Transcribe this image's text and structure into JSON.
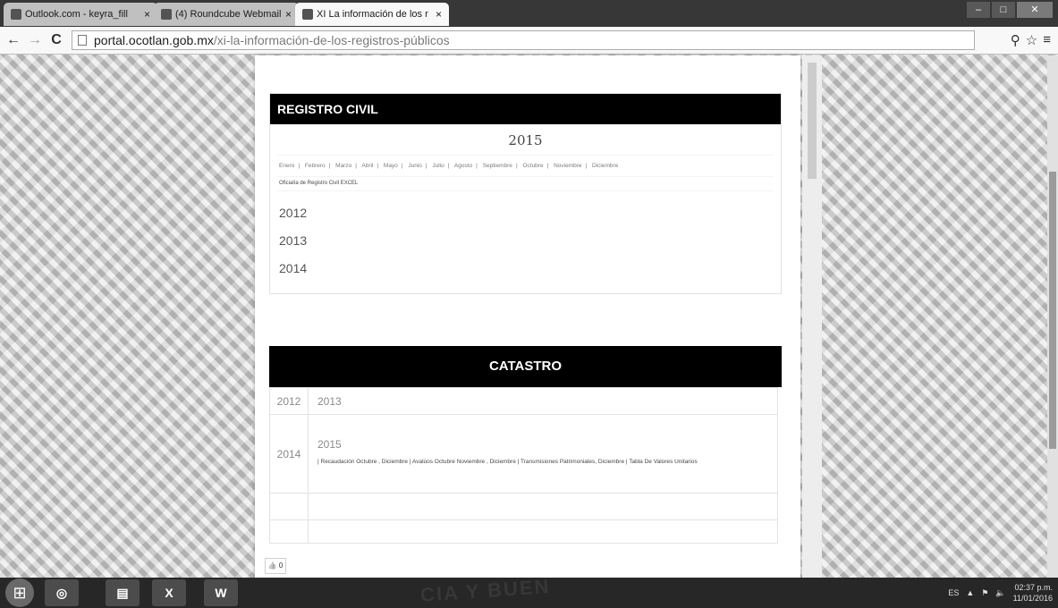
{
  "browser": {
    "tabs": [
      {
        "label": "Outlook.com - keyra_fill"
      },
      {
        "label": "(4) Roundcube Webmail"
      },
      {
        "label": "XI La información de los r"
      }
    ],
    "address": {
      "domain": "portal.ocotlan.gob.mx",
      "path": "/xi-la-información-de-los-registros-públicos"
    }
  },
  "registro_civil": {
    "header": "REGISTRO CIVIL",
    "year": "2015",
    "months": [
      "Enero",
      "Febrero",
      "Marzo",
      "Abril",
      "Mayo",
      "Junio",
      "Julio",
      "Agosto",
      "Septiembre",
      "Octubre",
      "Noviembre",
      "Diciembre"
    ],
    "office_label": "Oficialía de Registro Civil EXCEL",
    "years": [
      "2012",
      "2013",
      "2014"
    ]
  },
  "catastro": {
    "header": "CATASTRO",
    "row1": {
      "left": "2012",
      "right": "2013"
    },
    "row2": {
      "left": "2014",
      "year": "2015",
      "links": "| Recaudación Octubre , Diciembre | Avalúos Octubre Noviembre , Diciembre | Transmisiones Patrimoniales, Diciembre | Tabla De Valores Unitarios"
    }
  },
  "like_label": "👍 0",
  "taskbar": {
    "wallpaper_text": "CIA Y BUEN",
    "apps": [
      "chrome-icon",
      "explorer-icon",
      "excel-icon",
      "word-icon"
    ],
    "lang": "ES",
    "time": "02:37 p.m.",
    "date": "11/01/2016"
  }
}
